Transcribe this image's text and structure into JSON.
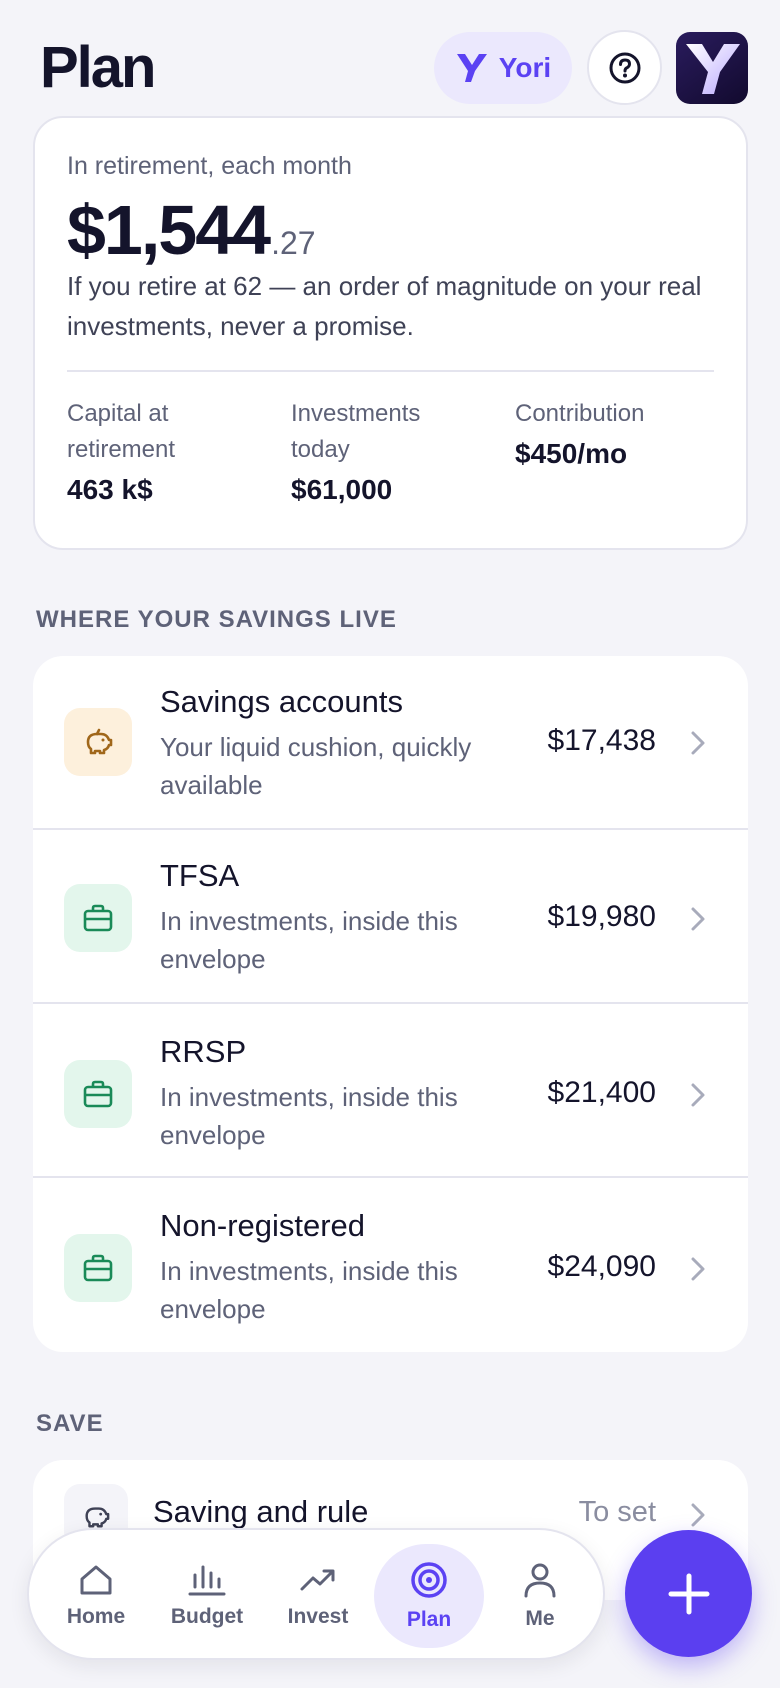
{
  "header": {
    "title": "Plan",
    "assistant_label": "Yori",
    "help_icon": "question-circle-icon",
    "logo_icon": "y-logo-icon"
  },
  "hero": {
    "label": "In retirement, each month",
    "amount_main": "$1,544",
    "amount_cents": ".27",
    "note": "If you retire at 62 — an order of magnitude on your real investments, never a promise.",
    "stats": [
      {
        "label": "Capital at retirement",
        "value": "463 k$"
      },
      {
        "label": "Investments today",
        "value": "$61,000"
      },
      {
        "label": "Contribution",
        "value": "$450/mo"
      }
    ]
  },
  "savings": {
    "section_title": "WHERE YOUR SAVINGS LIVE",
    "items": [
      {
        "title": "Savings accounts",
        "subtitle": "Your liquid cushion, quickly available",
        "amount": "$17,438",
        "icon": "piggy-bank-icon"
      },
      {
        "title": "TFSA",
        "subtitle": "In investments, inside this envelope",
        "amount": "$19,980",
        "icon": "briefcase-icon"
      },
      {
        "title": "RRSP",
        "subtitle": "In investments, inside this envelope",
        "amount": "$21,400",
        "icon": "briefcase-icon"
      },
      {
        "title": "Non-registered",
        "subtitle": "In investments, inside this envelope",
        "amount": "$24,090",
        "icon": "briefcase-icon"
      }
    ]
  },
  "save": {
    "section_title": "SAVE",
    "item": {
      "title": "Saving and rule",
      "value": "To set",
      "icon": "piggy-bank-icon"
    }
  },
  "tabbar": {
    "tabs": [
      {
        "label": "Home",
        "icon": "home-icon"
      },
      {
        "label": "Budget",
        "icon": "bar-chart-icon"
      },
      {
        "label": "Invest",
        "icon": "trend-up-icon"
      },
      {
        "label": "Plan",
        "icon": "target-icon",
        "active": true
      },
      {
        "label": "Me",
        "icon": "user-icon"
      }
    ]
  },
  "colors": {
    "accent": "#5b42f3",
    "background": "#f4f4f9",
    "savings_icon_bg": "#fdf0dc",
    "invest_icon_bg": "#e3f6ec",
    "invest_icon": "#1a8a58",
    "savings_icon": "#a0671a"
  }
}
